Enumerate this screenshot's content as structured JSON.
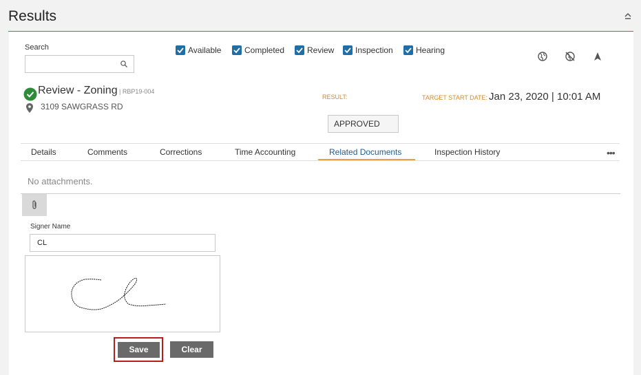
{
  "header": {
    "title": "Results",
    "collapse_icon": "chevron-up-icon"
  },
  "search": {
    "label": "Search",
    "value": "",
    "placeholder": ""
  },
  "filters": [
    {
      "label": "Available",
      "checked": true
    },
    {
      "label": "Completed",
      "checked": true
    },
    {
      "label": "Review",
      "checked": true
    },
    {
      "label": "Inspection",
      "checked": true
    },
    {
      "label": "Hearing",
      "checked": true
    }
  ],
  "toolbar_icons": [
    "globe-icon",
    "globe-off-icon",
    "navigation-arrow-icon"
  ],
  "record": {
    "title": "Review - Zoning",
    "id": "| RBP19-004",
    "address": "3109 SAWGRASS RD",
    "status_icon": "check-circle-icon",
    "status_color": "#2e8b3a"
  },
  "result": {
    "label": "RESULT:",
    "value": "APPROVED"
  },
  "target_start": {
    "label": "TARGET START DATE:",
    "value": "Jan 23, 2020 | 10:01 AM"
  },
  "tabs": [
    {
      "label": "Details",
      "active": false
    },
    {
      "label": "Comments",
      "active": false
    },
    {
      "label": "Corrections",
      "active": false
    },
    {
      "label": "Time Accounting",
      "active": false
    },
    {
      "label": "Related Documents",
      "active": true
    },
    {
      "label": "Inspection History",
      "active": false
    }
  ],
  "more_label": "•••",
  "documents": {
    "empty_text": "No attachments."
  },
  "signature": {
    "signer_label": "Signer Name",
    "signer_value": "CL"
  },
  "buttons": {
    "save": "Save",
    "clear": "Clear"
  },
  "colors": {
    "accent": "#1e6ea7",
    "label_orange": "#d4892a",
    "active_tab": "#1e5a93",
    "tab_underline": "#e0a240",
    "header_rule": "#3f8f5a"
  }
}
